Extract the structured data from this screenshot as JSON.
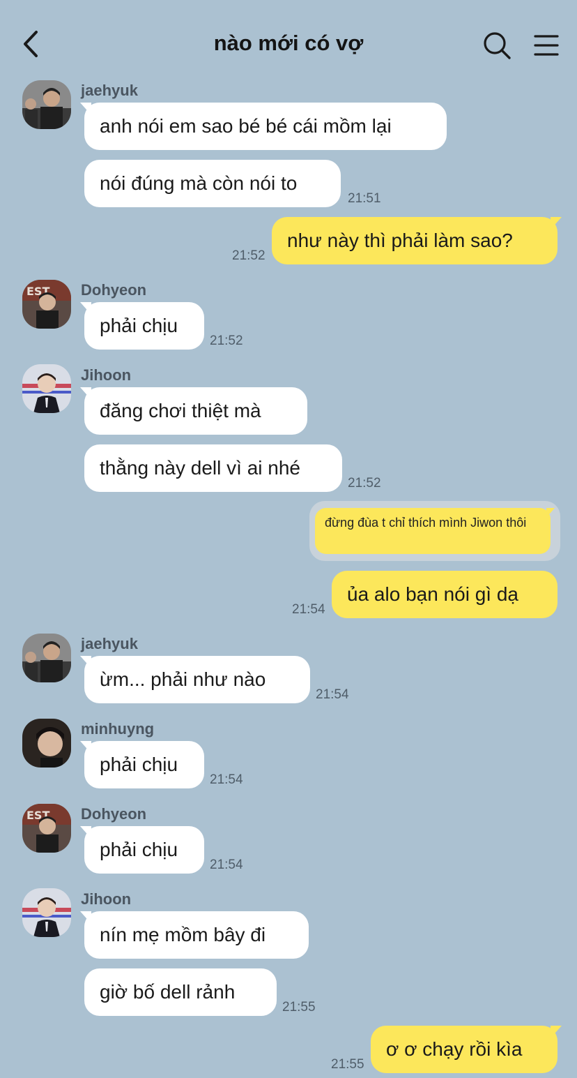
{
  "header": {
    "title": "nào mới có vợ",
    "back_icon": "back-arrow-icon",
    "search_icon": "search-icon",
    "menu_icon": "hamburger-menu-icon"
  },
  "colors": {
    "background": "#abc1d1",
    "incoming_bubble": "#ffffff",
    "outgoing_bubble": "#fce75b",
    "timestamp": "#4f5d69"
  },
  "messages": [
    {
      "sender": "jaehyuk",
      "text": "anh nói em sao bé bé cái mồm lại"
    },
    {
      "text": "nói đúng mà còn nói to",
      "time": "21:51"
    },
    {
      "text": "như này thì phải làm sao?",
      "time": "21:52",
      "outgoing": true
    },
    {
      "sender": "Dohyeon",
      "text": "phải chịu",
      "time": "21:52"
    },
    {
      "sender": "Jihoon",
      "text": "đăng chơi thiệt mà"
    },
    {
      "text": "thằng này dell vì ai nhé",
      "time": "21:52"
    },
    {
      "text": "đừng đùa t chỉ thích mình Jiwon thôi",
      "outgoing": true,
      "quoted": true
    },
    {
      "text": "ủa alo bạn nói gì dạ",
      "time": "21:54",
      "outgoing": true
    },
    {
      "sender": "jaehyuk",
      "text": "ừm... phải như nào",
      "time": "21:54"
    },
    {
      "sender": "minhuyng",
      "text": "phải chịu",
      "time": "21:54"
    },
    {
      "sender": "Dohyeon",
      "text": "phải chịu",
      "time": "21:54"
    },
    {
      "sender": "Jihoon",
      "text": "nín mẹ mồm bây đi"
    },
    {
      "text": "giờ bố dell rảnh",
      "time": "21:55"
    },
    {
      "text": "ơ ơ chạy rồi kìa",
      "time": "21:55",
      "outgoing": true
    }
  ]
}
